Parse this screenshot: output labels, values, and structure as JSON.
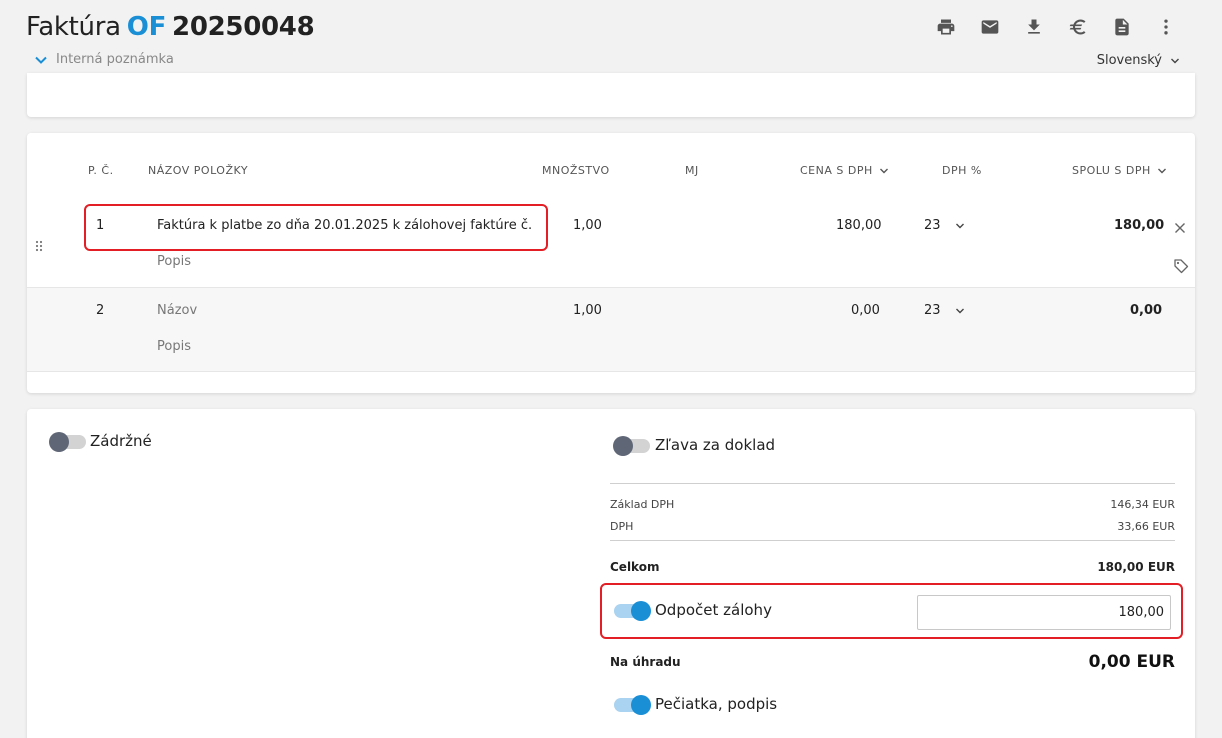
{
  "header": {
    "doc_label": "Faktúra",
    "prefix": "OF",
    "number": "20250048",
    "note_toggle": "Interná poznámka",
    "language": "Slovenský"
  },
  "toolbar": {
    "icons": [
      "print-icon",
      "mail-icon",
      "download-icon",
      "euro-icon",
      "document-icon",
      "more-icon"
    ]
  },
  "table": {
    "headers": {
      "no": "P. Č.",
      "name": "NÁZOV POLOŽKY",
      "qty": "MNOŽSTVO",
      "unit": "MJ",
      "price": "CENA S DPH",
      "vat": "DPH %",
      "total": "SPOLU S DPH"
    },
    "rows": [
      {
        "no": "1",
        "name": "Faktúra k platbe zo dňa 20.01.2025 k zálohovej faktúre č.",
        "desc": "Popis",
        "qty": "1,00",
        "unit": "",
        "price": "180,00",
        "vat": "23",
        "total": "180,00"
      },
      {
        "no": "2",
        "name": "Názov",
        "desc": "Popis",
        "qty": "1,00",
        "unit": "",
        "price": "0,00",
        "vat": "23",
        "total": "0,00"
      }
    ]
  },
  "summary": {
    "retention_label": "Zádržné",
    "retention_on": false,
    "discount_label": "Zľava za doklad",
    "discount_on": false,
    "base_label": "Základ DPH",
    "base_value": "146,34 EUR",
    "vat_label": "DPH",
    "vat_value": "33,66 EUR",
    "total_label": "Celkom",
    "total_value": "180,00 EUR",
    "deduction_label": "Odpočet zálohy",
    "deduction_on": true,
    "deduction_value": "180,00",
    "due_label": "Na úhradu",
    "due_value": "0,00 EUR",
    "stamp_label": "Pečiatka, podpis",
    "stamp_on": true
  },
  "colors": {
    "accent": "#1a8fd6",
    "highlight": "#e31e24",
    "toggle_off": "#5f6676"
  }
}
